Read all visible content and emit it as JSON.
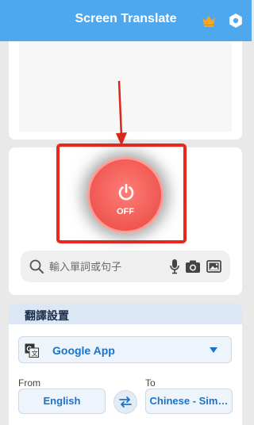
{
  "header": {
    "title": "Screen Translate",
    "crown_icon": "crown-icon",
    "settings_icon": "gear-icon"
  },
  "translator": {
    "power_state": "OFF",
    "power_icon": "power-icon"
  },
  "search": {
    "placeholder": "輸入單詞或句子",
    "icons": [
      "search-icon",
      "mic-icon",
      "camera-icon",
      "image-icon"
    ]
  },
  "settings": {
    "title": "翻譯設置",
    "app": "Google App",
    "from_label": "From",
    "from_value": "English",
    "to_label": "To",
    "to_value": "Chinese - Sim…"
  },
  "colors": {
    "header": "#4fa8ee",
    "power_button": "#f25c56",
    "highlight": "#e8281c",
    "accent_text": "#1b73c9",
    "crown": "#f5a623"
  }
}
